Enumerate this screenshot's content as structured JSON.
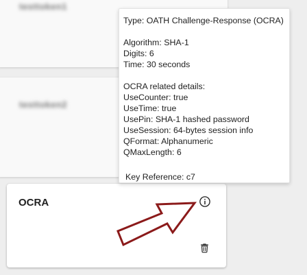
{
  "cards": {
    "first": {
      "title": "testtoken1"
    },
    "second": {
      "title": "testtoken2"
    },
    "ocra": {
      "title": "OCRA"
    }
  },
  "tooltip": {
    "type_line": "Type: OATH Challenge-Response (OCRA)",
    "algorithm": "Algorithm: SHA-1",
    "digits": "Digits: 6",
    "time": "Time: 30 seconds",
    "ocra_header": "OCRA related details:",
    "use_counter": "UseCounter: true",
    "use_time": "UseTime: true",
    "use_pin": "UsePin: SHA-1 hashed password",
    "use_session": "UseSession: 64-bytes session info",
    "qformat": "QFormat: Alphanumeric",
    "qmaxlength": "QMaxLength: 6",
    "key_reference": "Key Reference: c7"
  },
  "icons": {
    "info": "info-circle-icon",
    "delete": "trash-icon",
    "annotation": "red-arrow-annotation"
  },
  "colors": {
    "background": "#eeeeee",
    "card": "#ffffff",
    "arrow_outline": "#8b1a1a"
  }
}
